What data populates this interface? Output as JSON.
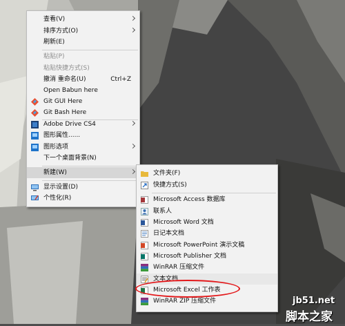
{
  "main_menu": {
    "items": [
      {
        "label": "查看(V)"
      },
      {
        "label": "排序方式(O)"
      },
      {
        "label": "刷新(E)"
      },
      {
        "label": "粘贴(P)"
      },
      {
        "label": "粘贴快捷方式(S)"
      },
      {
        "label": "撤消 重命名(U)",
        "shortcut": "Ctrl+Z"
      },
      {
        "label": "Open Babun here"
      },
      {
        "label": "Git GUI Here"
      },
      {
        "label": "Git Bash Here"
      },
      {
        "label": "Adobe Drive CS4"
      },
      {
        "label": "图形属性......"
      },
      {
        "label": "图形选项"
      },
      {
        "label": "下一个桌面背景(N)"
      },
      {
        "label": "新建(W)"
      },
      {
        "label": "显示设置(D)"
      },
      {
        "label": "个性化(R)"
      }
    ]
  },
  "sub_menu": {
    "items": [
      {
        "label": "文件夹(F)"
      },
      {
        "label": "快捷方式(S)"
      },
      {
        "label": "Microsoft Access 数据库"
      },
      {
        "label": "联系人"
      },
      {
        "label": "Microsoft Word 文档"
      },
      {
        "label": "日记本文档"
      },
      {
        "label": "Microsoft PowerPoint 演示文稿"
      },
      {
        "label": "Microsoft Publisher 文档"
      },
      {
        "label": "WinRAR 压缩文件"
      },
      {
        "label": "文本文档"
      },
      {
        "label": "Microsoft Excel 工作表"
      },
      {
        "label": "WinRAR ZIP 压缩文件"
      }
    ]
  },
  "watermark": {
    "line1": "jb51.net",
    "line2": "脚本之家"
  },
  "colors": {
    "menu_bg": "#f2f2f2",
    "highlight": "#d6d6d6",
    "annotation_ring": "#e3181a"
  }
}
